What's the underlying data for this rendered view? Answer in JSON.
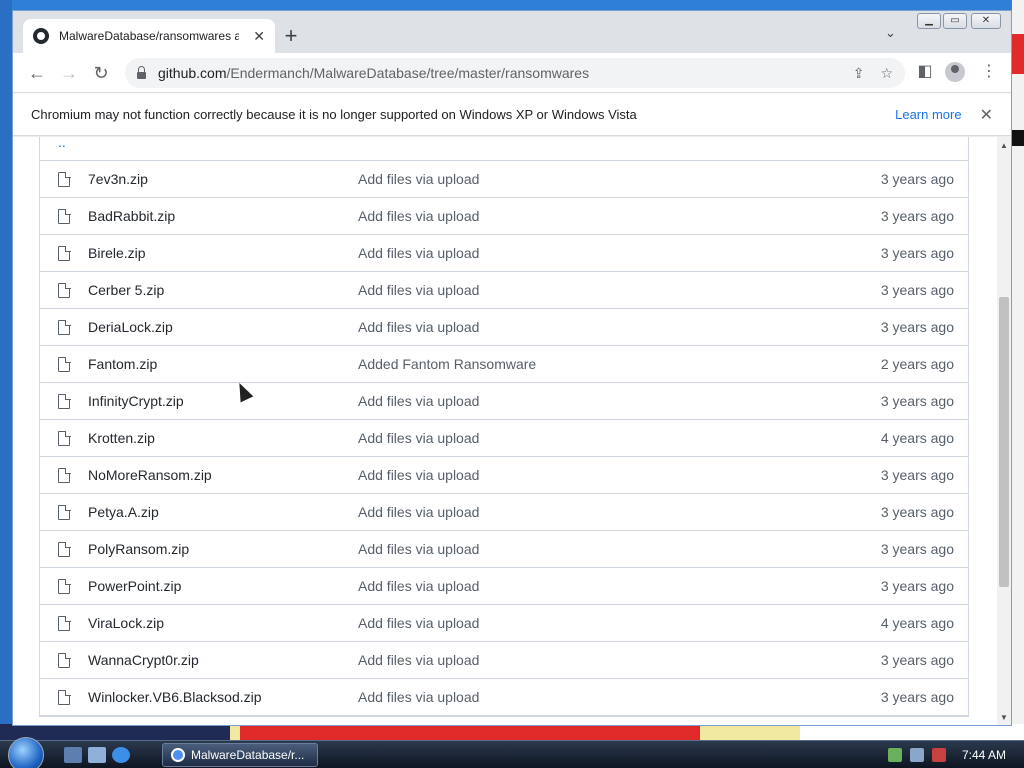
{
  "browser": {
    "tab_title": "MalwareDatabase/ransomwares a",
    "url_host": "github.com",
    "url_path": "/Endermanch/MalwareDatabase/tree/master/ransomwares",
    "infobar": {
      "message": "Chromium may not function correctly because it is no longer supported on Windows XP or Windows Vista",
      "learn_more": "Learn more"
    }
  },
  "file_list": {
    "parent": "..",
    "rows": [
      {
        "name": "7ev3n.zip",
        "commit": "Add files via upload",
        "age": "3 years ago"
      },
      {
        "name": "BadRabbit.zip",
        "commit": "Add files via upload",
        "age": "3 years ago"
      },
      {
        "name": "Birele.zip",
        "commit": "Add files via upload",
        "age": "3 years ago"
      },
      {
        "name": "Cerber 5.zip",
        "commit": "Add files via upload",
        "age": "3 years ago"
      },
      {
        "name": "DeriaLock.zip",
        "commit": "Add files via upload",
        "age": "3 years ago"
      },
      {
        "name": "Fantom.zip",
        "commit": "Added Fantom Ransomware",
        "age": "2 years ago"
      },
      {
        "name": "InfinityCrypt.zip",
        "commit": "Add files via upload",
        "age": "3 years ago"
      },
      {
        "name": "Krotten.zip",
        "commit": "Add files via upload",
        "age": "4 years ago"
      },
      {
        "name": "NoMoreRansom.zip",
        "commit": "Add files via upload",
        "age": "3 years ago"
      },
      {
        "name": "Petya.A.zip",
        "commit": "Add files via upload",
        "age": "3 years ago"
      },
      {
        "name": "PolyRansom.zip",
        "commit": "Add files via upload",
        "age": "3 years ago"
      },
      {
        "name": "PowerPoint.zip",
        "commit": "Add files via upload",
        "age": "3 years ago"
      },
      {
        "name": "ViraLock.zip",
        "commit": "Add files via upload",
        "age": "4 years ago"
      },
      {
        "name": "WannaCrypt0r.zip",
        "commit": "Add files via upload",
        "age": "3 years ago"
      },
      {
        "name": "Winlocker.VB6.Blacksod.zip",
        "commit": "Add files via upload",
        "age": "3 years ago"
      }
    ]
  },
  "taskbar": {
    "task_label": "MalwareDatabase/r...",
    "clock": "7:44 AM"
  },
  "icons": {
    "tab_favicon": "github-icon",
    "file": "file-icon"
  }
}
